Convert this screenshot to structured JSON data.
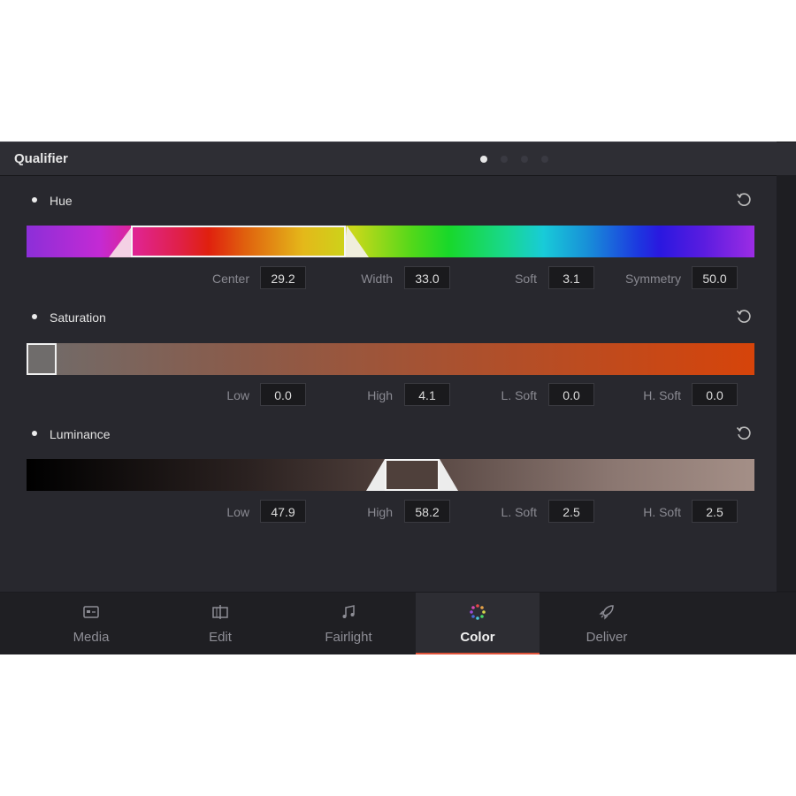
{
  "qualifier": {
    "title": "Qualifier",
    "pages": 4,
    "active_page": 0
  },
  "hue": {
    "title": "Hue",
    "fields": [
      {
        "label": "Center",
        "value": "29.2"
      },
      {
        "label": "Width",
        "value": "33.0"
      },
      {
        "label": "Soft",
        "value": "3.1"
      },
      {
        "label": "Symmetry",
        "value": "50.0"
      }
    ]
  },
  "saturation": {
    "title": "Saturation",
    "fields": [
      {
        "label": "Low",
        "value": "0.0"
      },
      {
        "label": "High",
        "value": "4.1"
      },
      {
        "label": "L. Soft",
        "value": "0.0"
      },
      {
        "label": "H. Soft",
        "value": "0.0"
      }
    ]
  },
  "luminance": {
    "title": "Luminance",
    "fields": [
      {
        "label": "Low",
        "value": "47.9"
      },
      {
        "label": "High",
        "value": "58.2"
      },
      {
        "label": "L. Soft",
        "value": "2.5"
      },
      {
        "label": "H. Soft",
        "value": "2.5"
      }
    ]
  },
  "tabs": [
    {
      "label": "Media",
      "icon": "media-icon"
    },
    {
      "label": "Edit",
      "icon": "edit-icon"
    },
    {
      "label": "Fairlight",
      "icon": "music-note-icon"
    },
    {
      "label": "Color",
      "icon": "color-wheel-icon",
      "active": true
    },
    {
      "label": "Deliver",
      "icon": "rocket-icon"
    }
  ],
  "colors": {
    "accent": "#e0533a",
    "panel": "#28282e",
    "header": "#2e2e34"
  }
}
